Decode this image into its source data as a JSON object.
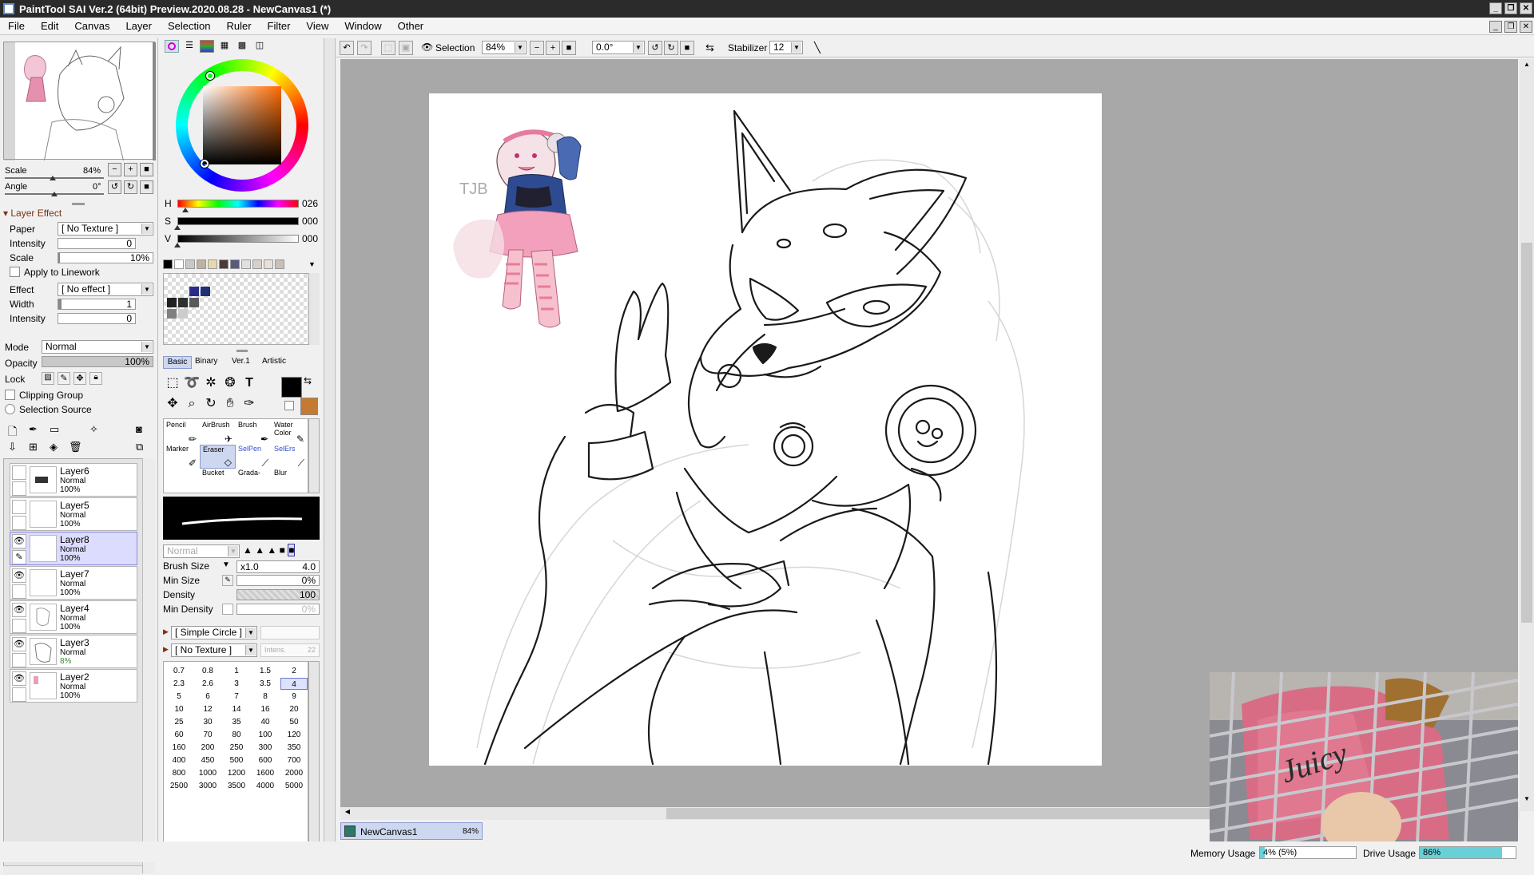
{
  "window": {
    "title": "PaintTool SAI Ver.2 (64bit) Preview.2020.08.28 - NewCanvas1 (*)",
    "minimize": "_",
    "restore": "❐",
    "close": "✕"
  },
  "menu": [
    "File",
    "Edit",
    "Canvas",
    "Layer",
    "Selection",
    "Ruler",
    "Filter",
    "View",
    "Window",
    "Other"
  ],
  "navigator": {
    "scale_label": "Scale",
    "scale_value": "84%",
    "angle_label": "Angle",
    "angle_value": "0°",
    "scale_fraction": 0.84
  },
  "layer_effect": {
    "header": "Layer Effect",
    "paper_label": "Paper",
    "paper_value": "[ No Texture ]",
    "intensity_label": "Intensity",
    "intensity_value": "0",
    "scale_label": "Scale",
    "scale_value": "10%",
    "apply_linework": "Apply to Linework",
    "effect_label": "Effect",
    "effect_value": "[ No effect ]",
    "width_label": "Width",
    "width_value": "1",
    "intensity2_label": "Intensity",
    "intensity2_value": "0"
  },
  "layer_props": {
    "mode_label": "Mode",
    "mode_value": "Normal",
    "opacity_label": "Opacity",
    "opacity_value": "100%",
    "lock_label": "Lock",
    "clipping_group": "Clipping Group",
    "selection_source": "Selection Source"
  },
  "layers": [
    {
      "name": "Layer6",
      "mode": "Normal",
      "opacity": "100%",
      "visible": false,
      "selected": false
    },
    {
      "name": "Layer5",
      "mode": "Normal",
      "opacity": "100%",
      "visible": false,
      "selected": false
    },
    {
      "name": "Layer8",
      "mode": "Normal",
      "opacity": "100%",
      "visible": true,
      "selected": true
    },
    {
      "name": "Layer7",
      "mode": "Normal",
      "opacity": "100%",
      "visible": true,
      "selected": false
    },
    {
      "name": "Layer4",
      "mode": "Normal",
      "opacity": "100%",
      "visible": true,
      "selected": false
    },
    {
      "name": "Layer3",
      "mode": "Normal",
      "opacity": "8%",
      "visible": true,
      "selected": false
    },
    {
      "name": "Layer2",
      "mode": "Normal",
      "opacity": "100%",
      "visible": true,
      "selected": false
    }
  ],
  "color": {
    "h_label": "H",
    "h_value": "026",
    "s_label": "S",
    "s_value": "000",
    "v_label": "V",
    "v_value": "000",
    "swatches": [
      "#000000",
      "#ffffff",
      "#c8c8c8",
      "#bcb2a0",
      "#e8d8b0",
      "#4a3a3a",
      "#5a5a7a",
      "#e0e0e0",
      "#d8d0c8",
      "#e8e0d8",
      "#c8c0b8"
    ],
    "scratch": [
      "#2a2a8a",
      "#203070",
      "#202020",
      "#303030",
      "#5a5a5a",
      "#808080",
      "#cccccc"
    ],
    "primary": "#000000",
    "secondary": "#c47a30"
  },
  "tool_tabs": [
    "Basic",
    "Binary",
    "Ver.1",
    "Artistic"
  ],
  "tools": [
    {
      "label": "Pencil",
      "selected": false
    },
    {
      "label": "AirBrush",
      "selected": false
    },
    {
      "label": "Brush",
      "selected": false
    },
    {
      "label": "Water Color",
      "selected": false
    },
    {
      "label": "Marker",
      "selected": false
    },
    {
      "label": "Eraser",
      "selected": true
    },
    {
      "label": "SelPen",
      "selected": false
    },
    {
      "label": "SelErs",
      "selected": false
    },
    {
      "label": "",
      "selected": false
    },
    {
      "label": "Bucket",
      "selected": false
    },
    {
      "label": "Grada-",
      "selected": false
    },
    {
      "label": "Blur",
      "selected": false
    }
  ],
  "brush": {
    "blend_mode": "Normal",
    "size_label": "Brush Size",
    "size_mult": "x1.0",
    "size_value": "4.0",
    "min_size_label": "Min Size",
    "min_size_value": "0%",
    "density_label": "Density",
    "density_value": "100",
    "min_density_label": "Min Density",
    "min_density_value": "0%",
    "shape": "[ Simple Circle ]",
    "texture": "[ No Texture ]",
    "intens_label": "Intens.",
    "intens_value": "22",
    "sizes": [
      "0.7",
      "0.8",
      "1",
      "1.5",
      "2",
      "2.3",
      "2.6",
      "3",
      "3.5",
      "4",
      "5",
      "6",
      "7",
      "8",
      "9",
      "10",
      "12",
      "14",
      "16",
      "20",
      "25",
      "30",
      "35",
      "40",
      "50",
      "60",
      "70",
      "80",
      "100",
      "120",
      "160",
      "200",
      "250",
      "300",
      "350",
      "400",
      "450",
      "500",
      "600",
      "700",
      "800",
      "1000",
      "1200",
      "1600",
      "2000",
      "2500",
      "3000",
      "3500",
      "4000",
      "5000"
    ],
    "selected_size": "4"
  },
  "toolbar": {
    "selection_label": "Selection",
    "zoom_value": "84%",
    "angle_value": "0.0°",
    "stabilizer_label": "Stabilizer",
    "stabilizer_value": "12"
  },
  "canvas_tab": {
    "name": "NewCanvas1",
    "zoom": "84%"
  },
  "status": {
    "memory_label": "Memory Usage",
    "memory_value": "4% (5%)",
    "memory_fraction": 0.05,
    "drive_label": "Drive Usage",
    "drive_value": "86%",
    "drive_fraction": 0.86
  },
  "sketch": {
    "signature_text": "TJB"
  },
  "webcam": {
    "bag_text": "Juicy"
  }
}
